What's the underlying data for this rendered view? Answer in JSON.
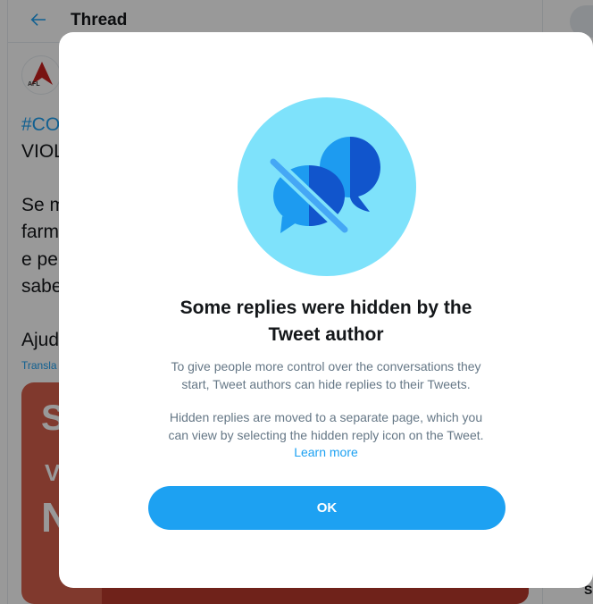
{
  "header": {
    "title": "Thread",
    "back_icon": "arrow-left-icon"
  },
  "tweet": {
    "line1": "#CO",
    "line2": "VIOL",
    "line3": "Se m",
    "line4": "farm",
    "line5": "e pe",
    "line6": "sabe",
    "line7": "Ajud",
    "translate": "Transla",
    "avatar_text": "AFL",
    "media_letters": [
      "S",
      "V",
      "N"
    ]
  },
  "sidebar": {
    "search_icon": "search-icon",
    "bottom_text": "S"
  },
  "modal": {
    "icon": "hidden-replies-icon",
    "title_line1": "Some replies were hidden by the",
    "title_line2": "Tweet author",
    "para1_line1": "To give people more control over the conversations they",
    "para1_line2": "start, Tweet authors can hide replies to their Tweets.",
    "para2_line1": "Hidden replies are moved to a separate page, which you",
    "para2_line2": "can view by selecting the hidden reply icon on the Tweet.",
    "learn_more": "Learn more",
    "ok_label": "OK"
  },
  "colors": {
    "accent": "#1da1f2",
    "illustration_bg": "#7ee2fb",
    "bubble_light": "#1d9bf0",
    "bubble_dark": "#1155cc",
    "overlay": "rgba(0,0,0,0.4)"
  }
}
